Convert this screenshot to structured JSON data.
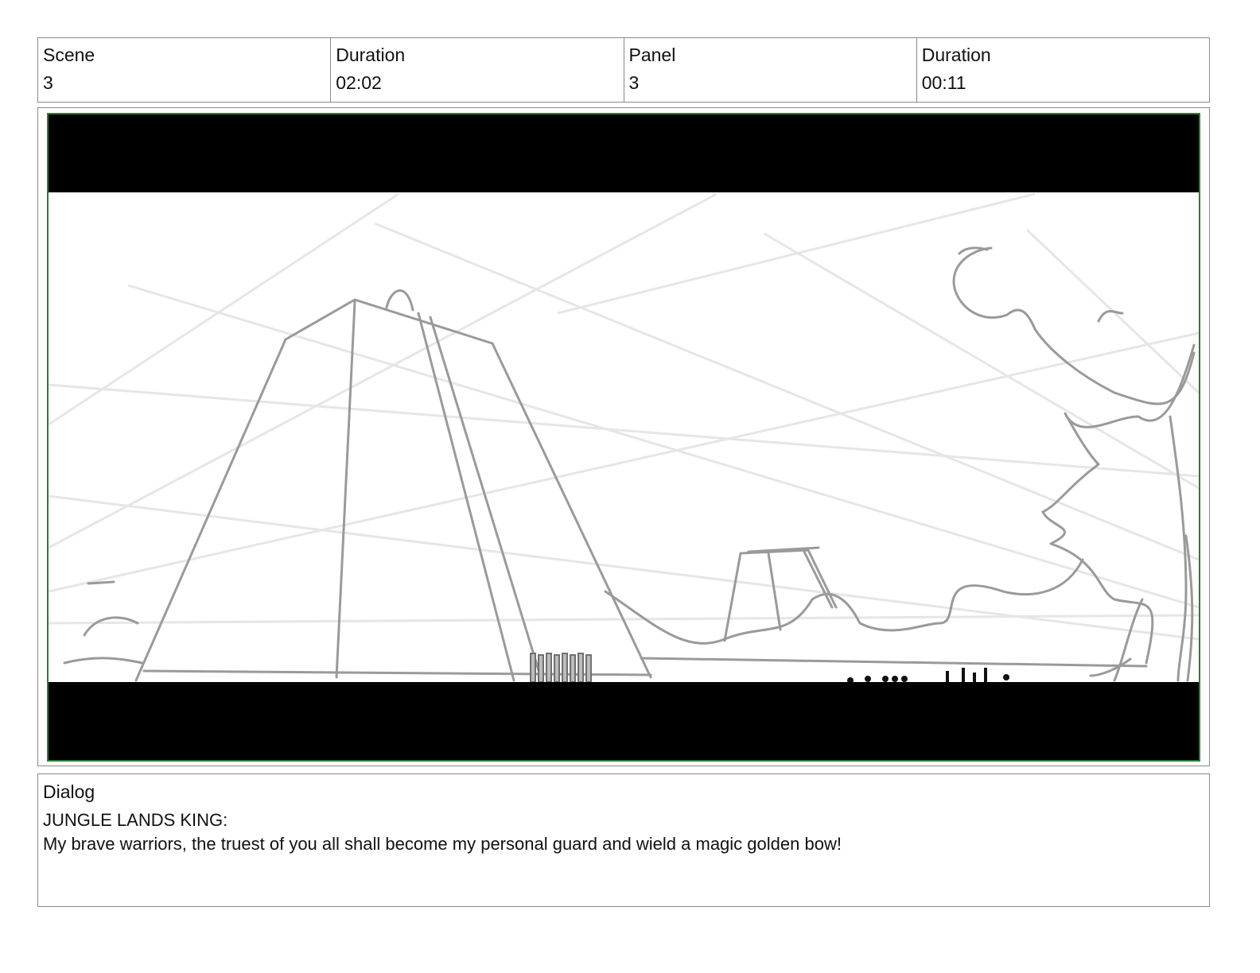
{
  "header": {
    "scene_label": "Scene",
    "scene_value": "3",
    "scene_duration_label": "Duration",
    "scene_duration_value": "02:02",
    "panel_label": "Panel",
    "panel_value": "3",
    "panel_duration_label": "Duration",
    "panel_duration_value": "00:11"
  },
  "panel": {
    "letterbox_color": "#000000",
    "frame_color": "#2e7d32",
    "sketch_color": "#9a9a9a"
  },
  "dialog": {
    "label": "Dialog",
    "speaker": "JUNGLE LANDS KING:",
    "line": "My brave warriors, the truest of you all shall become my personal guard and wield a magic golden bow!"
  }
}
